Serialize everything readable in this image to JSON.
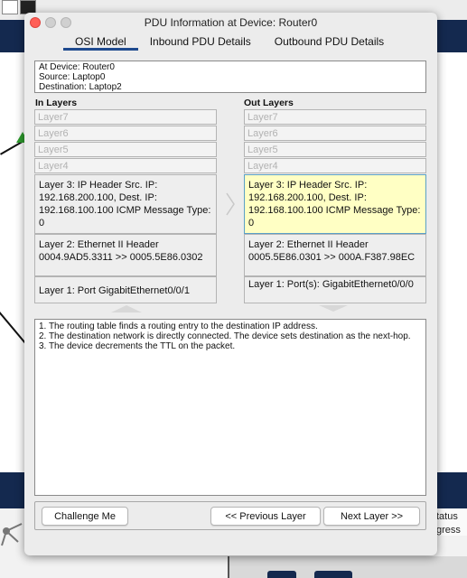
{
  "dialog": {
    "title": "PDU Information at Device: Router0"
  },
  "tabs": [
    {
      "label": "OSI Model",
      "active": true
    },
    {
      "label": "Inbound PDU Details",
      "active": false
    },
    {
      "label": "Outbound PDU Details",
      "active": false
    }
  ],
  "device_info": {
    "device": "At Device: Router0",
    "source": "Source: Laptop0",
    "destination": "Destination: Laptop2"
  },
  "in_layers": {
    "title": "In Layers",
    "items": [
      {
        "label": "Layer7",
        "enabled": false
      },
      {
        "label": "Layer6",
        "enabled": false
      },
      {
        "label": "Layer5",
        "enabled": false
      },
      {
        "label": "Layer4",
        "enabled": false
      },
      {
        "label": "Layer 3: IP Header Src. IP: 192.168.200.100, Dest. IP: 192.168.100.100 ICMP Message Type: 0",
        "enabled": true
      },
      {
        "label": "Layer 2: Ethernet II Header 0004.9AD5.3311 >> 0005.5E86.0302",
        "enabled": true
      },
      {
        "label": "Layer 1: Port GigabitEthernet0/0/1",
        "enabled": true
      }
    ]
  },
  "out_layers": {
    "title": "Out Layers",
    "items": [
      {
        "label": "Layer7",
        "enabled": false
      },
      {
        "label": "Layer6",
        "enabled": false
      },
      {
        "label": "Layer5",
        "enabled": false
      },
      {
        "label": "Layer4",
        "enabled": false
      },
      {
        "label": "Layer 3: IP Header Src. IP: 192.168.200.100, Dest. IP: 192.168.100.100 ICMP Message Type: 0",
        "enabled": true,
        "selected": true
      },
      {
        "label": "Layer 2: Ethernet II Header 0005.5E86.0301 >> 000A.F387.98EC",
        "enabled": true
      },
      {
        "label": "Layer 1: Port(s): GigabitEthernet0/0/0",
        "enabled": true
      }
    ]
  },
  "description": [
    "1. The routing table finds a routing entry to the destination IP address.",
    "2. The destination network is directly connected. The device sets destination as the next-hop.",
    "3. The device decrements the TTL on the packet."
  ],
  "buttons": {
    "challenge": "Challenge Me",
    "previous": "<< Previous Layer",
    "next": "Next Layer >>"
  },
  "background": {
    "status_label_1": "tatus",
    "status_label_2": "gress"
  },
  "colors": {
    "selected_layer_bg": "#ffffc4",
    "selected_layer_border": "#5aa0c8",
    "tab_underline": "#1f4a8e",
    "app_band": "#14294f"
  }
}
